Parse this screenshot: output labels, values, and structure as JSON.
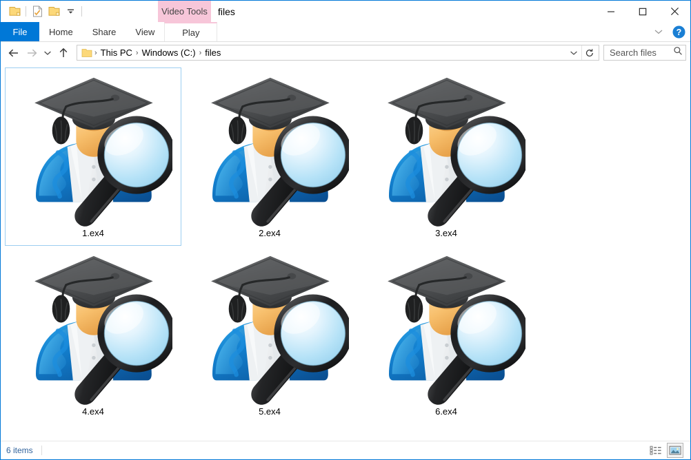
{
  "window": {
    "title": "files",
    "contextual_tools_label": "Video Tools",
    "accent_color": "#0078d7",
    "contextual_color": "#f7c6d9",
    "selection_border_color": "#9ccef0"
  },
  "quick_access_toolbar": {
    "items": [
      {
        "name": "folder-icon",
        "tooltip": "Properties folder"
      },
      {
        "name": "properties-icon",
        "tooltip": "Properties"
      },
      {
        "name": "new-folder-icon",
        "tooltip": "New folder"
      },
      {
        "name": "customize-chevron-icon",
        "tooltip": "Customize Quick Access Toolbar"
      }
    ]
  },
  "window_controls": {
    "minimize": "─",
    "maximize": "□",
    "close": "✕"
  },
  "ribbon": {
    "tabs": [
      {
        "label": "File",
        "active": true
      },
      {
        "label": "Home",
        "active": false
      },
      {
        "label": "Share",
        "active": false
      },
      {
        "label": "View",
        "active": false
      },
      {
        "label": "Play",
        "active": false,
        "contextual": true
      }
    ],
    "collapse_label": "⌄",
    "help_label": "?"
  },
  "address_bar": {
    "back_label": "←",
    "forward_label": "→",
    "recent_label": "⌄",
    "up_label": "↑",
    "breadcrumb": [
      {
        "label": "This PC"
      },
      {
        "label": "Windows (C:)"
      },
      {
        "label": "files"
      }
    ],
    "separator": "›",
    "dropdown_label": "⌄",
    "refresh_label": "↻"
  },
  "search": {
    "placeholder": "Search files",
    "value": "Search files"
  },
  "files": [
    {
      "name": "1.ex4",
      "selected": true
    },
    {
      "name": "2.ex4",
      "selected": false
    },
    {
      "name": "3.ex4",
      "selected": false
    },
    {
      "name": "4.ex4",
      "selected": false
    },
    {
      "name": "5.ex4",
      "selected": false
    },
    {
      "name": "6.ex4",
      "selected": false
    }
  ],
  "status_bar": {
    "item_count_text": "6 items",
    "views": [
      {
        "name": "details-view-button",
        "active": false
      },
      {
        "name": "large-icons-view-button",
        "active": true
      }
    ]
  }
}
